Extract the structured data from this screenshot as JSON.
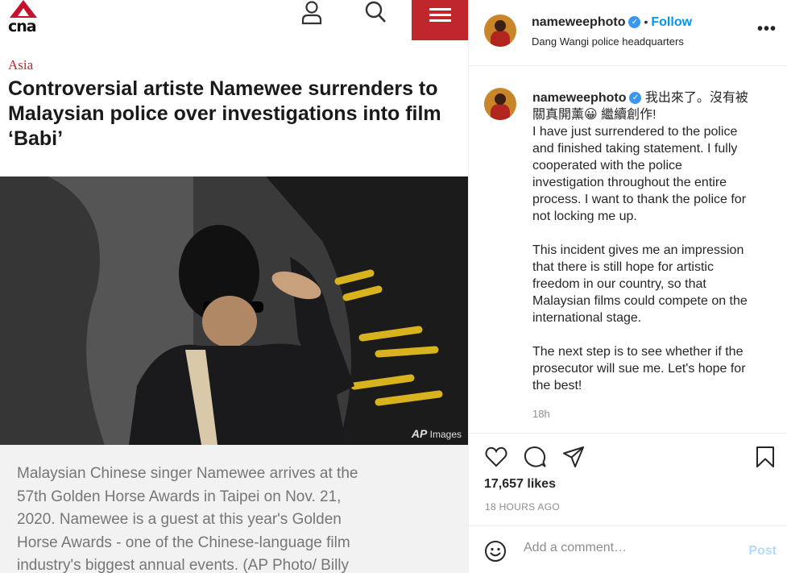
{
  "cna": {
    "logo_text": "cna",
    "category": "Asia",
    "title": "Controversial artiste Namewee surrenders to Malaysian police over investigations into film ‘Babi’",
    "photo_credit": "Images",
    "photo_credit_logo": "AP",
    "caption": "Malaysian Chinese singer Namewee arrives at the 57th Golden Horse Awards in Taipei on Nov. 21, 2020. Namewee is a guest at this year's Golden Horse Awards - one of the Chinese-language film industry's biggest annual events. (AP Photo/ Billy",
    "icons": [
      "user-icon",
      "search-icon",
      "menu-icon"
    ],
    "accent_color": "#c0272d"
  },
  "instagram": {
    "username": "nameweephoto",
    "follow_label": "Follow",
    "dot": "•",
    "location": "Dang Wangi police headquarters",
    "more_label": "•••",
    "caption_lines": [
      "我出來了。沒有被",
      "關真開薰😀 繼續創作!",
      "I have just surrendered to the police",
      "and finished taking statement. I fully",
      "cooperated with the police",
      "investigation throughout the entire",
      "process. I want to thank the police for",
      "not locking me up.",
      "",
      "This incident gives me an impression",
      "that there is still hope for artistic",
      "freedom in our country, so that",
      "Malaysian films could compete on the",
      "international stage.",
      "",
      "The next step is to see whether if the",
      "prosecutor will sue me. Let's hope for",
      "the best!"
    ],
    "time": "18h",
    "likes": "17,657 likes",
    "posted_ago": "18 HOURS AGO",
    "comment_placeholder": "Add a comment…",
    "post_label": "Post",
    "icons": [
      "heart-icon",
      "comment-icon",
      "share-icon",
      "bookmark-icon",
      "emoji-icon",
      "verified-badge-icon"
    ],
    "link_color": "#0095f6",
    "verified_color": "#3897f0"
  }
}
